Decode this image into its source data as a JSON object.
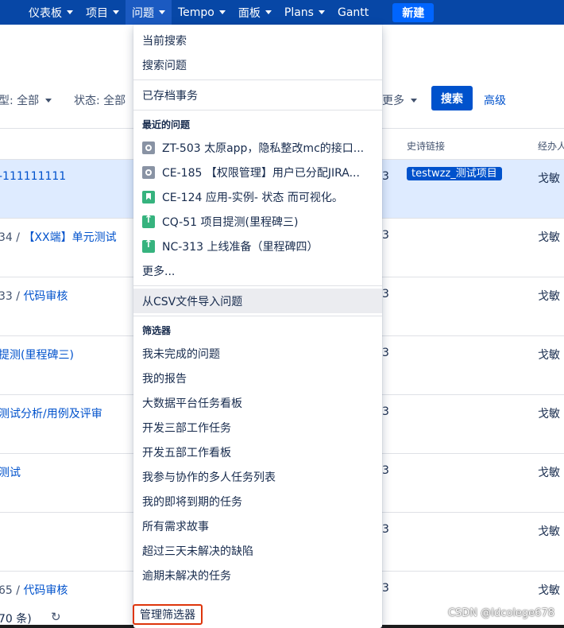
{
  "nav": {
    "items": [
      {
        "label": "仪表板"
      },
      {
        "label": "项目"
      },
      {
        "label": "问题"
      },
      {
        "label": "Tempo"
      },
      {
        "label": "面板"
      },
      {
        "label": "Plans"
      },
      {
        "label": "Gantt"
      }
    ],
    "create_label": "新建"
  },
  "filters": {
    "type_label": "型: 全部",
    "status_label": "状态: 全部",
    "more_label": "更多",
    "search_label": "搜索",
    "advanced_label": "高级"
  },
  "table": {
    "headers": {
      "epic_link": "史诗链接",
      "assignee": "经办人"
    },
    "rows": [
      {
        "prefix": "",
        "summary": "-111111111",
        "status": "3",
        "epic": "testwzz_测试项目",
        "assignee": "戈敏"
      },
      {
        "prefix": "34 / ",
        "summary": "【XX端】单元测试",
        "status": "3",
        "epic": "",
        "assignee": "戈敏"
      },
      {
        "prefix": "33 / ",
        "summary": "代码审核",
        "status": "3",
        "epic": "",
        "assignee": "戈敏"
      },
      {
        "prefix": "",
        "summary": "提测(里程碑三)",
        "status": "3",
        "epic": "",
        "assignee": "戈敏"
      },
      {
        "prefix": "",
        "summary": "测试分析/用例及评审",
        "status": "3",
        "epic": "",
        "assignee": "戈敏"
      },
      {
        "prefix": "",
        "summary": "测试",
        "status": "3",
        "epic": "",
        "assignee": "戈敏"
      },
      {
        "prefix": "",
        "summary": "",
        "status": "3",
        "epic": "",
        "assignee": "戈敏"
      },
      {
        "prefix": "65 / ",
        "summary": "代码审核",
        "status": "3",
        "epic": "",
        "assignee": "戈敏"
      }
    ],
    "footer_count": "70 条)"
  },
  "dropdown": {
    "current_search": "当前搜索",
    "search_issues": "搜索问题",
    "archived": "已存档事务",
    "recent_heading": "最近的问题",
    "recent": [
      {
        "icon": "task-icon",
        "text": "ZT-503 太原app，隐私整改mc的接口..."
      },
      {
        "icon": "task-icon",
        "text": "CE-185 【权限管理】用户已分配JIRA..."
      },
      {
        "icon": "story-icon",
        "text": "CE-124 应用-实例- 状态 而可视化。"
      },
      {
        "icon": "improvement-icon",
        "text": "CQ-51 项目提测(里程碑三)"
      },
      {
        "icon": "improvement-icon",
        "text": "NC-313 上线准备（里程碑四）"
      }
    ],
    "more": "更多...",
    "import_csv": "从CSV文件导入问题",
    "filters_heading": "筛选器",
    "filters": [
      "我未完成的问题",
      "我的报告",
      "大数据平台任务看板",
      "开发三部工作任务",
      "开发五部工作看板",
      "我参与协作的多人任务列表",
      "我的即将到期的任务",
      "所有需求故事",
      "超过三天未解决的缺陷",
      "逾期未解决的任务"
    ],
    "manage_filters": "管理筛选器"
  },
  "watermark": "CSDN @Idcolege678"
}
